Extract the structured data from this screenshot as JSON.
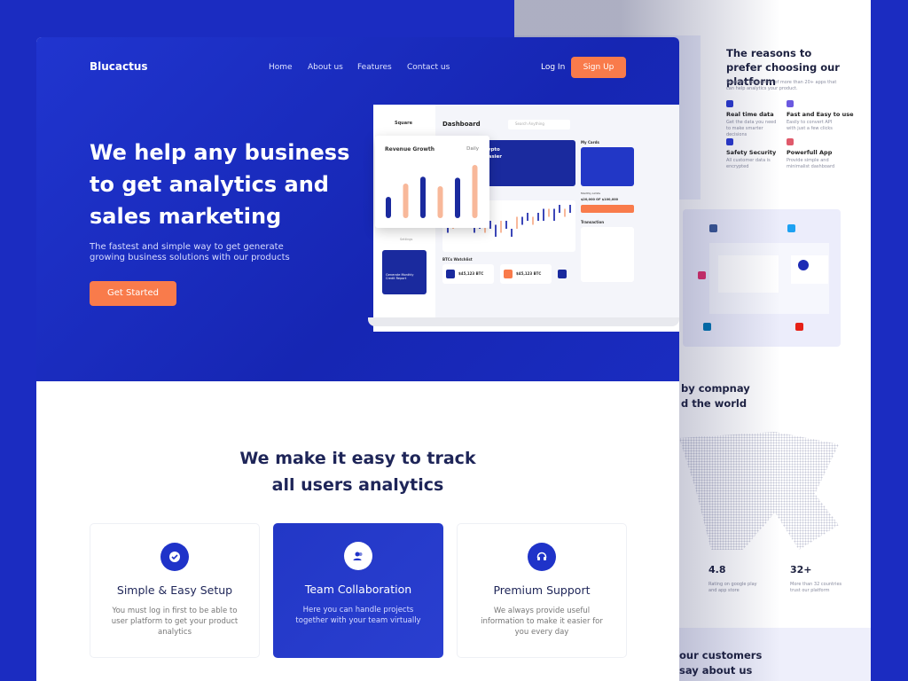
{
  "brand": "Blucactus",
  "nav": {
    "items": [
      "Home",
      "About us",
      "Features",
      "Contact us"
    ],
    "login": "Log In",
    "signup": "Sign Up"
  },
  "hero": {
    "title": "We help any business to get analytics and sales marketing",
    "subtitle": "The fastest and simple way to get generate growing business solutions with our products",
    "cta": "Get Started"
  },
  "revenue": {
    "title": "Revenue Growth",
    "period": "Daily",
    "values": [
      40,
      65,
      78,
      60,
      76,
      100
    ],
    "colors": [
      "#1a2a9e",
      "#f8b89a"
    ]
  },
  "dashboard": {
    "logo": "Square",
    "title": "Dashboard",
    "search": "Search Anything",
    "banner": "Make Your Crypto Transaction Easier",
    "banner_btn": "New Transaction",
    "market": "Market Overview",
    "cards": "My Cards",
    "limits": "Monthly Limits",
    "limit_value": "$20,000 OF $100,000",
    "transaction": "Transaction",
    "watchlist": "BTCs Watchlist",
    "btc1": "$45,123 BTC",
    "btc2": "$45,123 BTC",
    "settings": "Settings",
    "report": "Generate Monthly Credit Report",
    "candles": [
      [
        3,
        6
      ],
      [
        4,
        7
      ],
      [
        6,
        8
      ],
      [
        5,
        7
      ],
      [
        5,
        6
      ],
      [
        3,
        6
      ],
      [
        4,
        5
      ],
      [
        3,
        5
      ],
      [
        4,
        6
      ],
      [
        2,
        5
      ],
      [
        3,
        6
      ],
      [
        4,
        6
      ],
      [
        2,
        4
      ],
      [
        4,
        7
      ],
      [
        5,
        7
      ],
      [
        6,
        8
      ],
      [
        5,
        7
      ],
      [
        6,
        8
      ],
      [
        6,
        9
      ],
      [
        7,
        9
      ],
      [
        6,
        9
      ],
      [
        8,
        10
      ],
      [
        7,
        9
      ],
      [
        8,
        10
      ]
    ]
  },
  "section": {
    "title": "We make it easy to track all users analytics"
  },
  "features": [
    {
      "icon": "check-circle-icon",
      "title": "Simple & Easy Setup",
      "desc": "You must log in first to be able to user platform to get your product analytics"
    },
    {
      "icon": "team-icon",
      "title": "Team Collaboration",
      "desc": "Here you can handle projects together with your team virtually"
    },
    {
      "icon": "headset-icon",
      "title": "Premium Support",
      "desc": "We always provide useful information to make it easier for you every day"
    }
  ],
  "right": {
    "reasons_title": "The reasons to prefer choosing our platform",
    "reasons_sub": "Seamless integration of more than 20+ apps that can help analytics your product.",
    "reasons": [
      {
        "title": "Real time data",
        "desc": "Get the data you need to make smarter decisions"
      },
      {
        "title": "Fast and Easy to use",
        "desc": "Easily to convert API with just a few clicks"
      },
      {
        "title": "Safety Security",
        "desc": "All customer data is encrypted"
      },
      {
        "title": "Powerfull App",
        "desc": "Provide simple and minimalist dashboard"
      }
    ],
    "world_title": "by compnay\nd the world",
    "stats": [
      {
        "value": "4.8",
        "desc": "Rating on google play and app store"
      },
      {
        "value": "32+",
        "desc": "More than 32 countries trust our platform"
      }
    ],
    "testimonial_title": "our customers\nsay about us"
  },
  "colors": {
    "primary": "#1f33c9",
    "accent": "#f97b4b",
    "text": "#1e2558"
  }
}
